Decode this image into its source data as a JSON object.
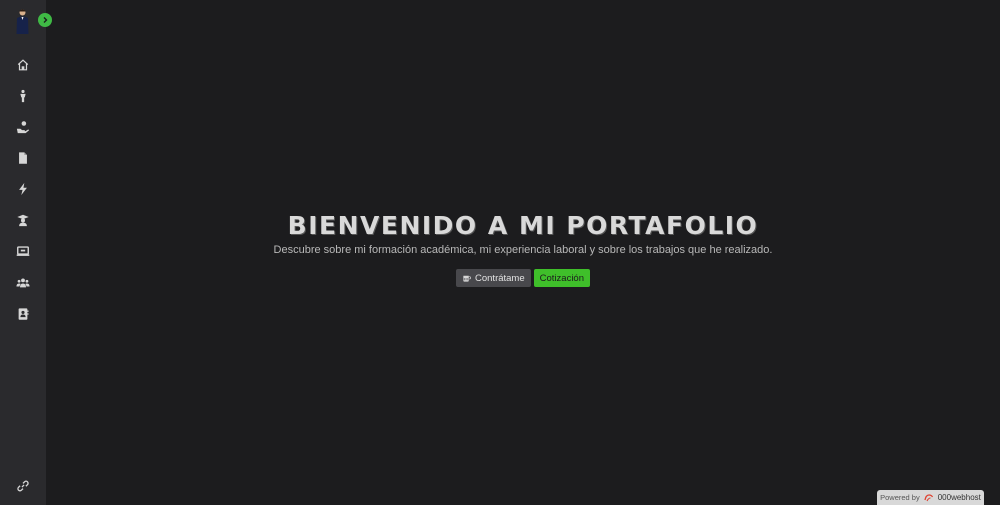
{
  "sidebar": {
    "toggle_icon": "chevron-right-icon",
    "accent": "#3fb945",
    "nav": [
      {
        "name": "home",
        "icon": "home-icon"
      },
      {
        "name": "about",
        "icon": "person-icon"
      },
      {
        "name": "services",
        "icon": "hand-heart-icon"
      },
      {
        "name": "resume",
        "icon": "document-icon"
      },
      {
        "name": "skills",
        "icon": "bolt-icon"
      },
      {
        "name": "education",
        "icon": "graduation-icon"
      },
      {
        "name": "portfolio",
        "icon": "laptop-icon"
      },
      {
        "name": "clients",
        "icon": "people-icon"
      },
      {
        "name": "contact",
        "icon": "contact-card-icon"
      }
    ],
    "bottom_icon": "link-icon"
  },
  "hero": {
    "title": "BIENVENIDO A MI PORTAFOLIO",
    "subtitle": "Descubre sobre mi formación académica, mi experiencia laboral y sobre los trabajos que he realizado.",
    "hire_label": "Contrátame",
    "hire_icon": "mug-icon",
    "quote_label": "Cotización",
    "quote_color": "#3fbf2a"
  },
  "footer": {
    "powered_label": "Powered by",
    "brand": "000webhost"
  }
}
